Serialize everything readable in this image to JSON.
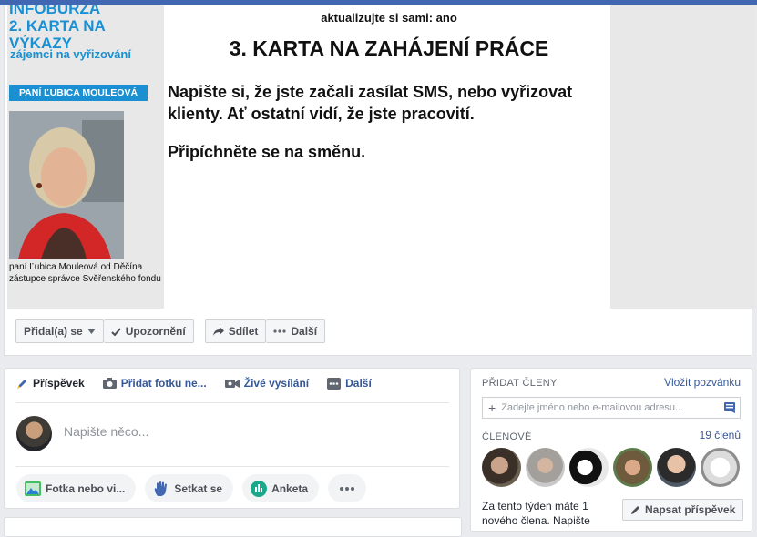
{
  "cover": {
    "left_title": "INFOBURZA\n2. KARTA NA VÝKAZY",
    "left_subtitle": "zájemci na vyřizování",
    "name_bar": "PANÍ ĽUBICA MOULEOVÁ",
    "caption_1": "paní Ľubica Mouleová od Děčína",
    "caption_2": "zástupce správce Svěřenského fondu",
    "top_line": "aktualizujte si sami: ano",
    "heading": "3. KARTA NA ZAHÁJENÍ PRÁCE",
    "paragraph_1": "Napište si, že jste začali zasílat SMS, nebo vyřizovat klienty. Ať ostatní vidí, že jste pracovití.",
    "paragraph_2": "Připíchněte se na směnu."
  },
  "actions": {
    "joined": "Přidal(a) se",
    "notifications": "Upozornění",
    "share": "Sdílet",
    "more": "Další"
  },
  "composer": {
    "tabs": [
      "Příspěvek",
      "Přidat fotku ne...",
      "Živé vysílání",
      "Další"
    ],
    "placeholder": "Napište něco...",
    "pills": [
      "Fotka nebo vi...",
      "Setkat se",
      "Anketa"
    ]
  },
  "sidebar": {
    "add_members_label": "PŘIDAT ČLENY",
    "invite_link": "Vložit pozvánku",
    "input_placeholder": "Zadejte jméno nebo e-mailovou adresu...",
    "members_label": "ČLENOVÉ",
    "members_count": "19 členů",
    "new_member_text": "Za tento týden máte 1 nového člena. Napište",
    "write_post": "Napsat příspěvek"
  },
  "colors": {
    "brand": "#4267b2",
    "link": "#365899",
    "accent_blue": "#1a8fd2"
  }
}
